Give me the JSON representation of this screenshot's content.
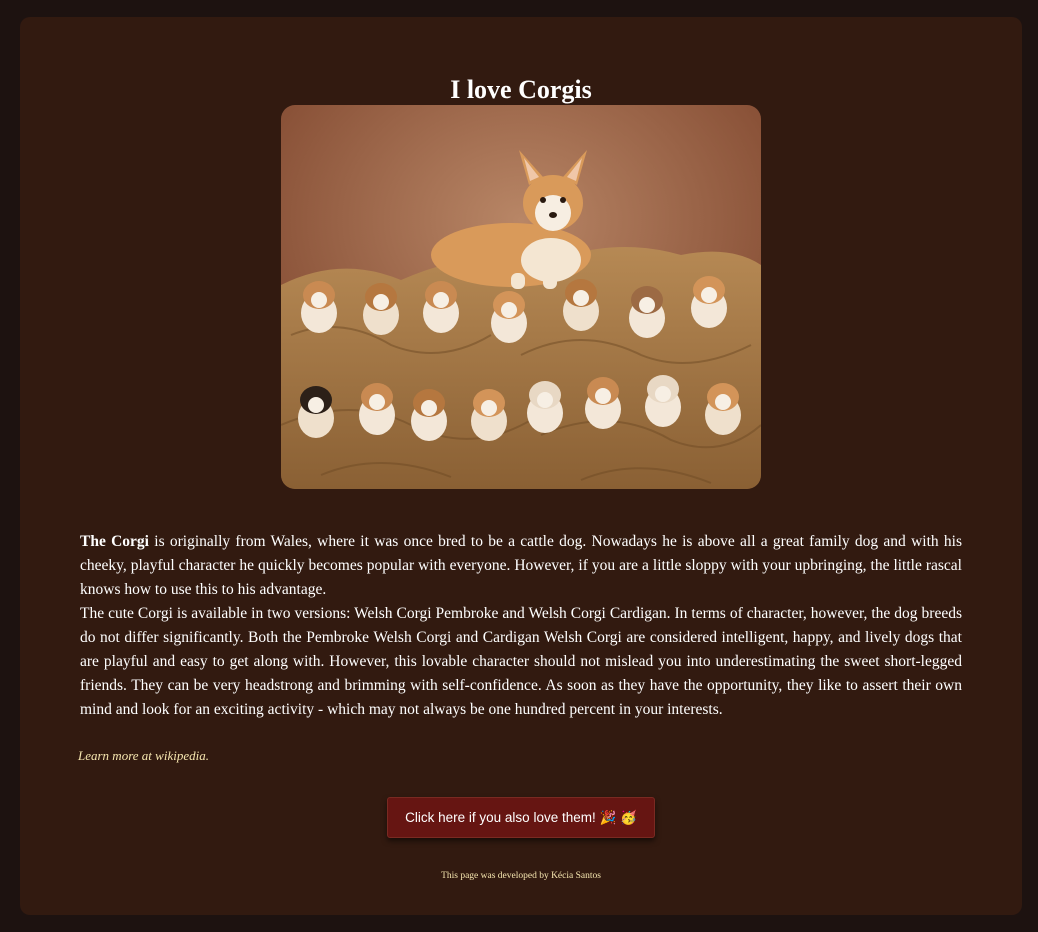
{
  "page": {
    "title": "I love Corgis"
  },
  "image": {
    "alt": "Corgi mother with her puppies"
  },
  "article": {
    "intro_bold": "The Corgi",
    "intro_rest": " is originally from Wales, where it was once bred to be a cattle dog. Nowadays he is above all a great family dog and with his cheeky, playful character he quickly becomes popular with everyone. However, if you are a little sloppy with your upbringing, the little rascal knows how to use this to his advantage.",
    "paragraph2": "The cute Corgi is available in two versions: Welsh Corgi Pembroke and Welsh Corgi Cardigan. In terms of character, however, the dog breeds do not differ significantly. Both the Pembroke Welsh Corgi and Cardigan Welsh Corgi are considered intelligent, happy, and lively dogs that are playful and easy to get along with. However, this lovable character should not mislead you into underestimating the sweet short-legged friends. They can be very headstrong and brimming with self-confidence. As soon as they have the opportunity, they like to assert their own mind and look for an exciting activity - which may not always be one hundred percent in your interests."
  },
  "link": {
    "label": "Learn more at wikipedia."
  },
  "button": {
    "label": "Click here if you also love them! 🎉 🥳"
  },
  "footer": {
    "text": "This page was developed by Kécia Santos"
  },
  "colors": {
    "page_background": "#1d1210",
    "card_background": "#321a10",
    "button_background": "#661512",
    "link_color": "#f7e7b0"
  }
}
